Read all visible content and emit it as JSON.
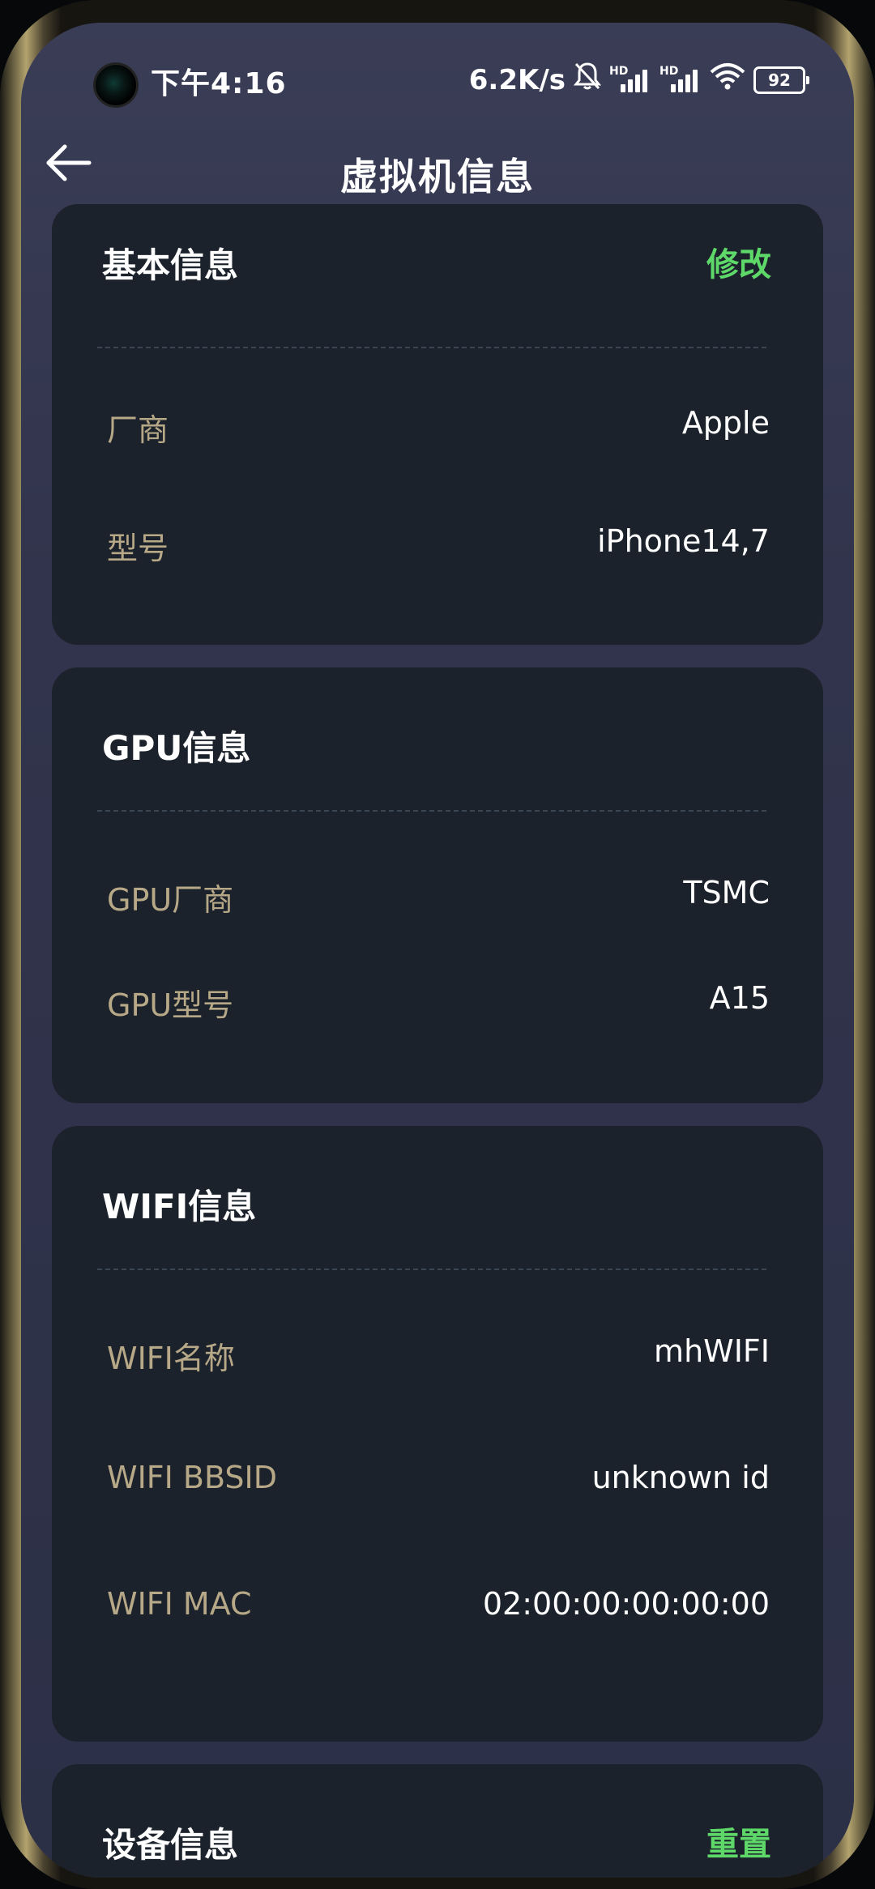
{
  "status_bar": {
    "time": "下午4:16",
    "net_speed": "6.2K/s",
    "sim1_label": "HD",
    "sim2_label": "HD",
    "battery": "92"
  },
  "header": {
    "title": "虚拟机信息"
  },
  "cards": {
    "basic": {
      "title": "基本信息",
      "action": "修改",
      "rows": [
        {
          "label": "厂商",
          "value": "Apple"
        },
        {
          "label": "型号",
          "value": "iPhone14,7"
        }
      ]
    },
    "gpu": {
      "title": "GPU信息",
      "rows": [
        {
          "label": "GPU厂商",
          "value": "TSMC"
        },
        {
          "label": "GPU型号",
          "value": "A15"
        }
      ]
    },
    "wifi": {
      "title": "WIFI信息",
      "rows": [
        {
          "label": "WIFI名称",
          "value": "mhWIFI"
        },
        {
          "label": "WIFI BBSID",
          "value": "unknown id"
        },
        {
          "label": "WIFI MAC",
          "value": "02:00:00:00:00:00"
        }
      ]
    },
    "device": {
      "title": "设备信息",
      "action": "重置"
    }
  },
  "colors": {
    "accent_green": "#5fd86a",
    "label_tan": "#b7a887",
    "card_bg": "#1b222b",
    "screen_bg": "#343850"
  },
  "icons": [
    "back-arrow-icon",
    "mute-bell-icon",
    "signal-icon",
    "wifi-icon",
    "battery-icon",
    "camera-icon"
  ]
}
